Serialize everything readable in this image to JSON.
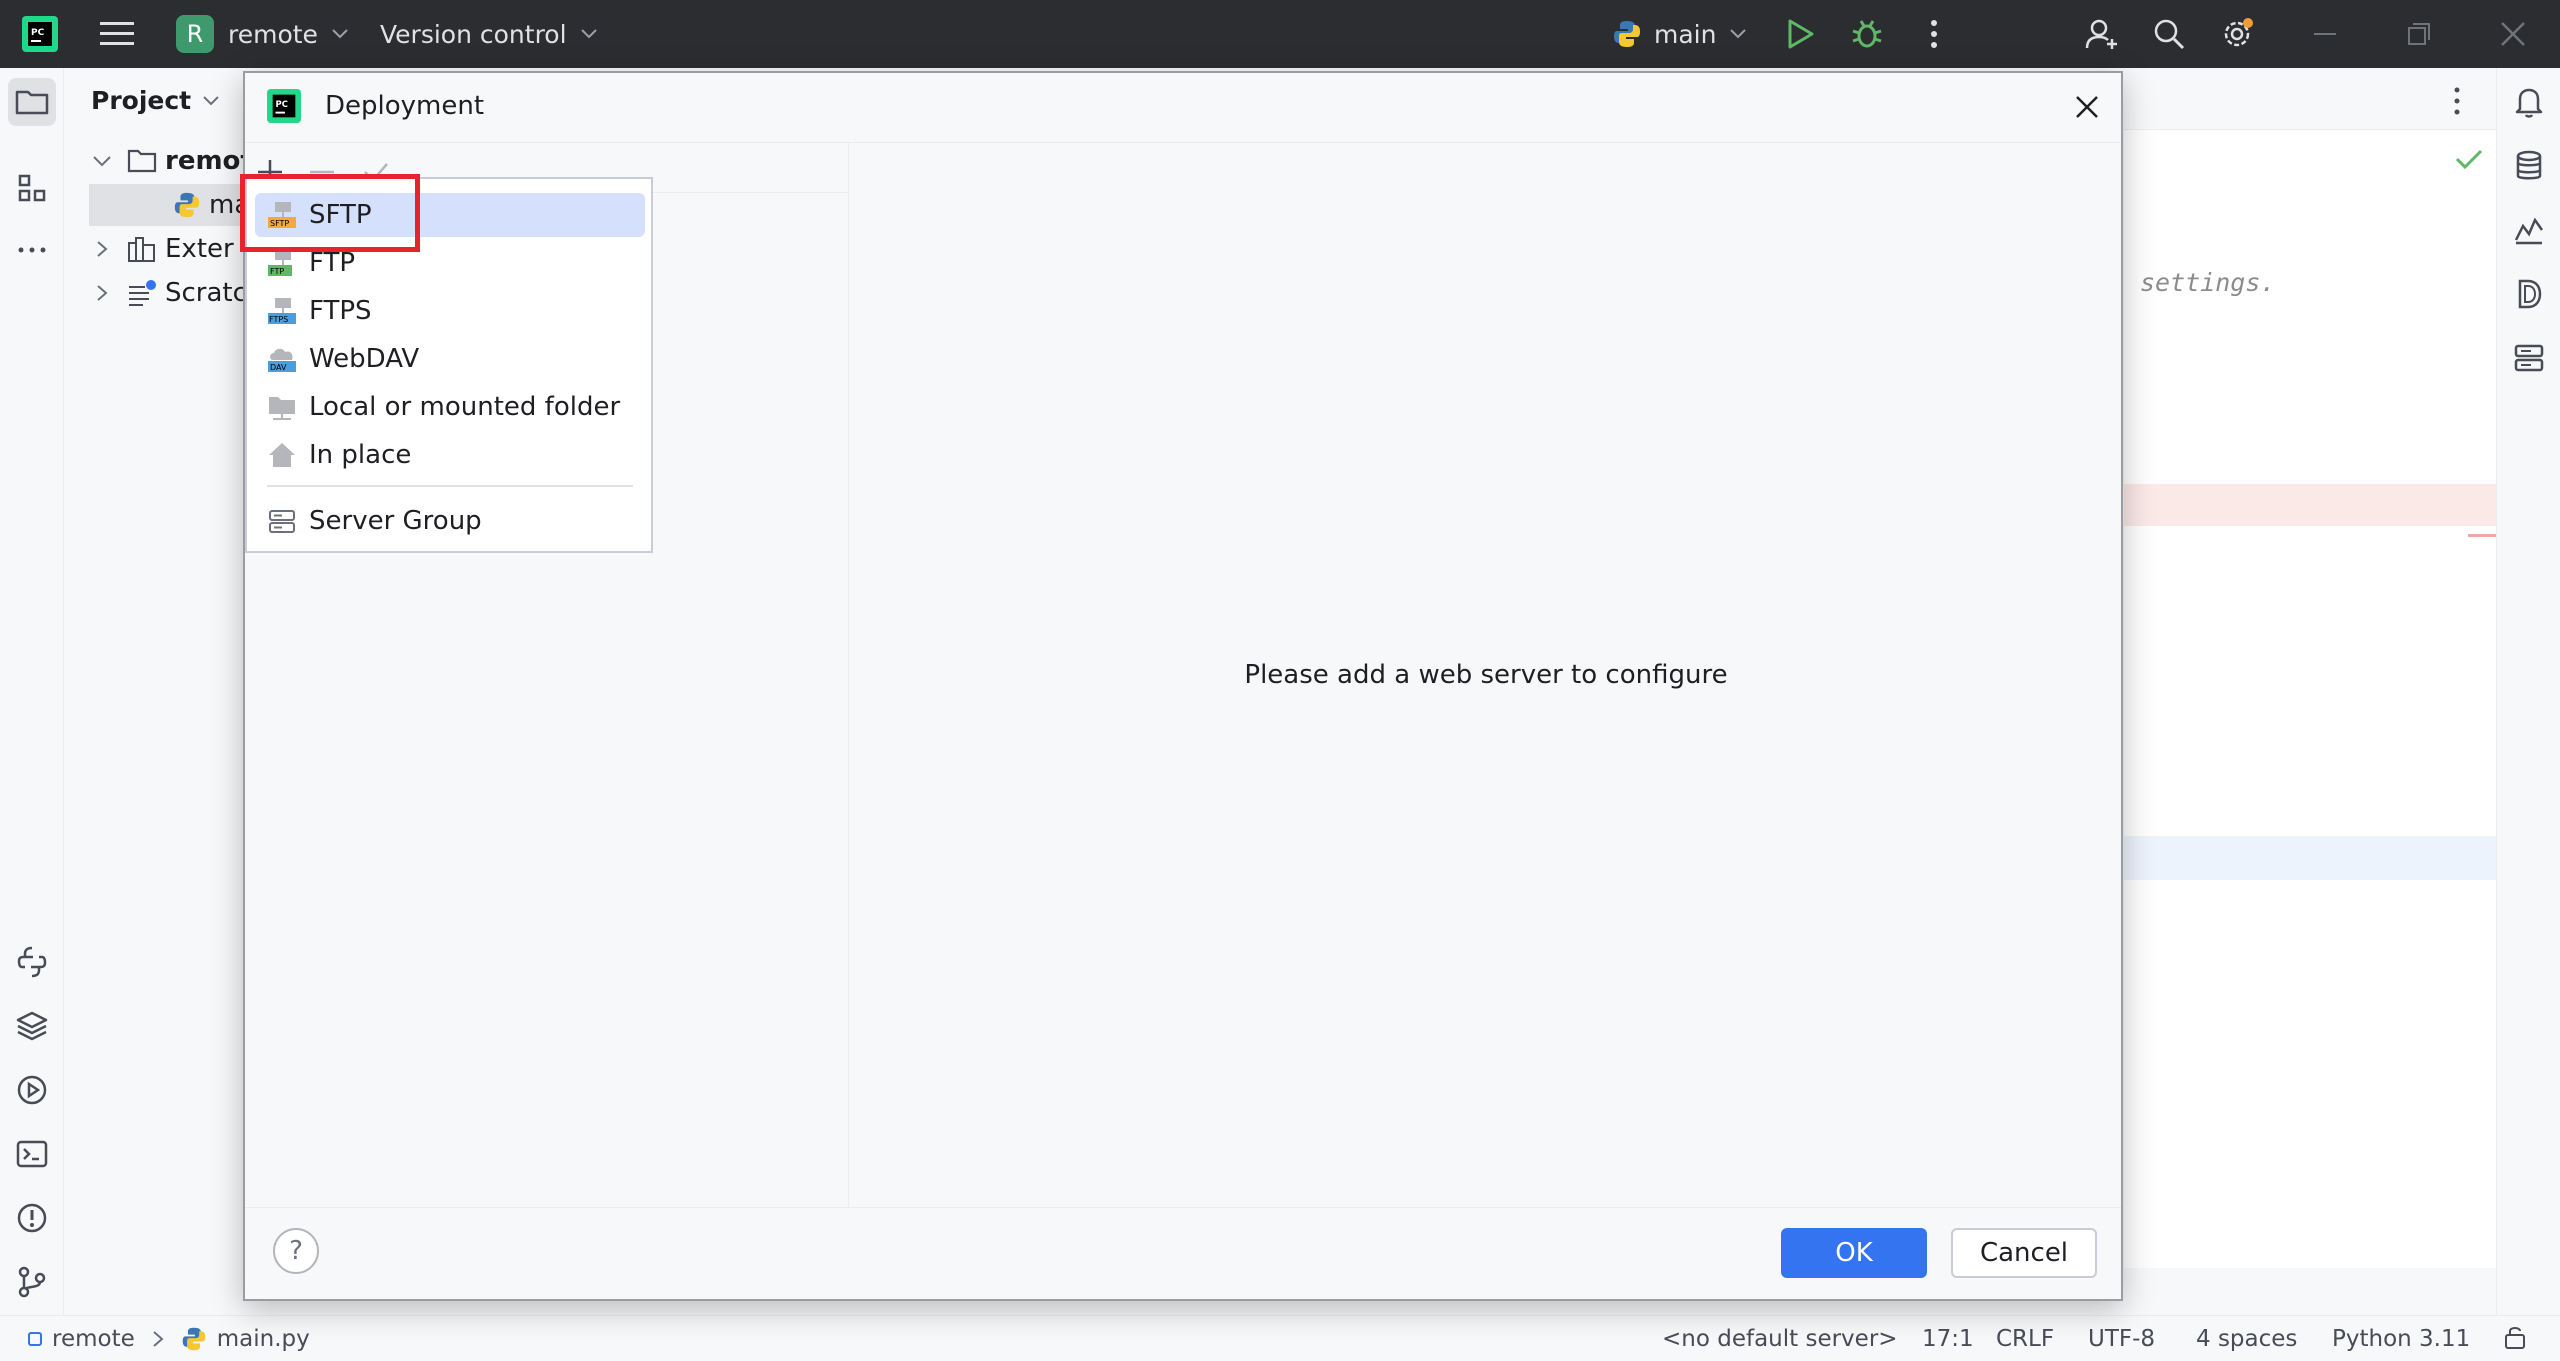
{
  "titlebar": {
    "project_badge": "R",
    "project_name": "remote",
    "version_control": "Version control",
    "run_config": "main"
  },
  "project_panel": {
    "title": "Project",
    "tree": [
      {
        "label": "remot",
        "type": "folder"
      },
      {
        "label": "ma",
        "type": "python-file"
      },
      {
        "label": "Exter",
        "type": "library"
      },
      {
        "label": "Scratc",
        "type": "scratches"
      }
    ]
  },
  "editor": {
    "visible_text": "settings."
  },
  "dialog": {
    "title": "Deployment",
    "empty_message": "Please add a web server to configure",
    "help_label": "?",
    "ok_label": "OK",
    "cancel_label": "Cancel"
  },
  "popup_menu": {
    "items": [
      {
        "label": "SFTP",
        "icon": "sftp-icon",
        "selected": true
      },
      {
        "label": "FTP",
        "icon": "ftp-icon"
      },
      {
        "label": "FTPS",
        "icon": "ftps-icon"
      },
      {
        "label": "WebDAV",
        "icon": "webdav-icon"
      },
      {
        "label": "Local or mounted folder",
        "icon": "folder-icon"
      },
      {
        "label": "In place",
        "icon": "home-icon"
      },
      {
        "label": "Server Group",
        "icon": "server-group-icon"
      }
    ]
  },
  "statusbar": {
    "breadcrumb_project": "remote",
    "breadcrumb_file": "main.py",
    "server": "<no default server>",
    "position": "17:1",
    "line_sep": "CRLF",
    "encoding": "UTF-8",
    "indent": "4 spaces",
    "interpreter": "Python 3.11"
  },
  "colors": {
    "accent": "#3574f0",
    "highlight_box": "#e8232e",
    "titlebar": "#2b2d30",
    "run_green": "#5fb865"
  }
}
